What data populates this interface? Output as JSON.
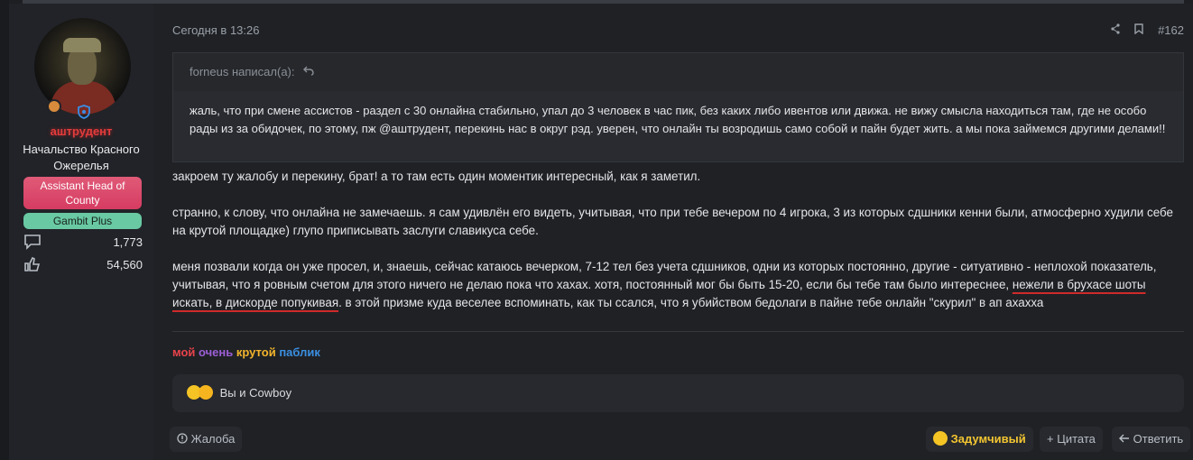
{
  "author": {
    "username": "аштрудент",
    "title": "Начальство Красного Ожерелья",
    "banner_primary": "Assistant Head of County",
    "banner_secondary": "Gambit Plus",
    "messages_count": "1,773",
    "reactions_count": "54,560"
  },
  "post": {
    "date": "Сегодня в 13:26",
    "number": "#162",
    "quote": {
      "author_line": "forneus написал(а):",
      "text": "жаль, что при смене ассистов - раздел с 30 онлайна стабильно, упал до 3 человек в час пик, без каких либо ивентов или движа. не вижу смысла находиться там, где не особо рады из за обидочек, по этому, пж @аштрудент, перекинь нас в округ рэд. уверен, что онлайн ты возродишь само собой и пайн будет жить. а мы пока займемся другими делами!!"
    },
    "paragraph1": "закроем ту жалобу и перекину, брат! а то там есть один моментик интересный, как я заметил.",
    "paragraph2": "странно, к слову, что онлайна не замечаешь. я сам удивлён его видеть, учитывая, что при тебе вечером по 4 игрока, 3 из которых сдшники кенни были, атмосферно худили себе на крутой площадке) глупо приписывать заслуги славикуса себе.",
    "paragraph3_a": "меня позвали когда он уже просел, и, знаешь, сейчас катаюсь вечерком, 7-12 тел без учета сдшников, одни из которых постоянно, другие - ситуативно - неплохой показатель, учитывая, что я ровным счетом для этого ничего не делаю пока что хахах. хотя, постоянный мог бы быть 15-20, если бы тебе там было интереснее, ",
    "paragraph3_underlined": "нежели в брухасе шоты искать, в дискорде попукивая",
    "paragraph3_b": ". в этой призме куда веселее вспоминать, как ты ссался, что я убийством бедолаги в пайне тебе онлайн \"скурил\" в ап ахахха"
  },
  "signature": {
    "word1": "мой",
    "color1": "#e8434b",
    "word2": "очень",
    "color2": "#9c5fd6",
    "word3": "крутой",
    "color3": "#f2b42c",
    "word4": "паблик",
    "color4": "#3b8fe0"
  },
  "reactions": {
    "summary": "Вы и Cowboy"
  },
  "actions": {
    "report": "Жалоба",
    "reaction": "Задумчивый",
    "quote": "+ Цитата",
    "reply": "Ответить"
  },
  "colors": {
    "username": "#e33c3c",
    "banner_primary": "#d63c61",
    "banner_secondary": "#69c9a3",
    "reaction": "#f3c531"
  }
}
